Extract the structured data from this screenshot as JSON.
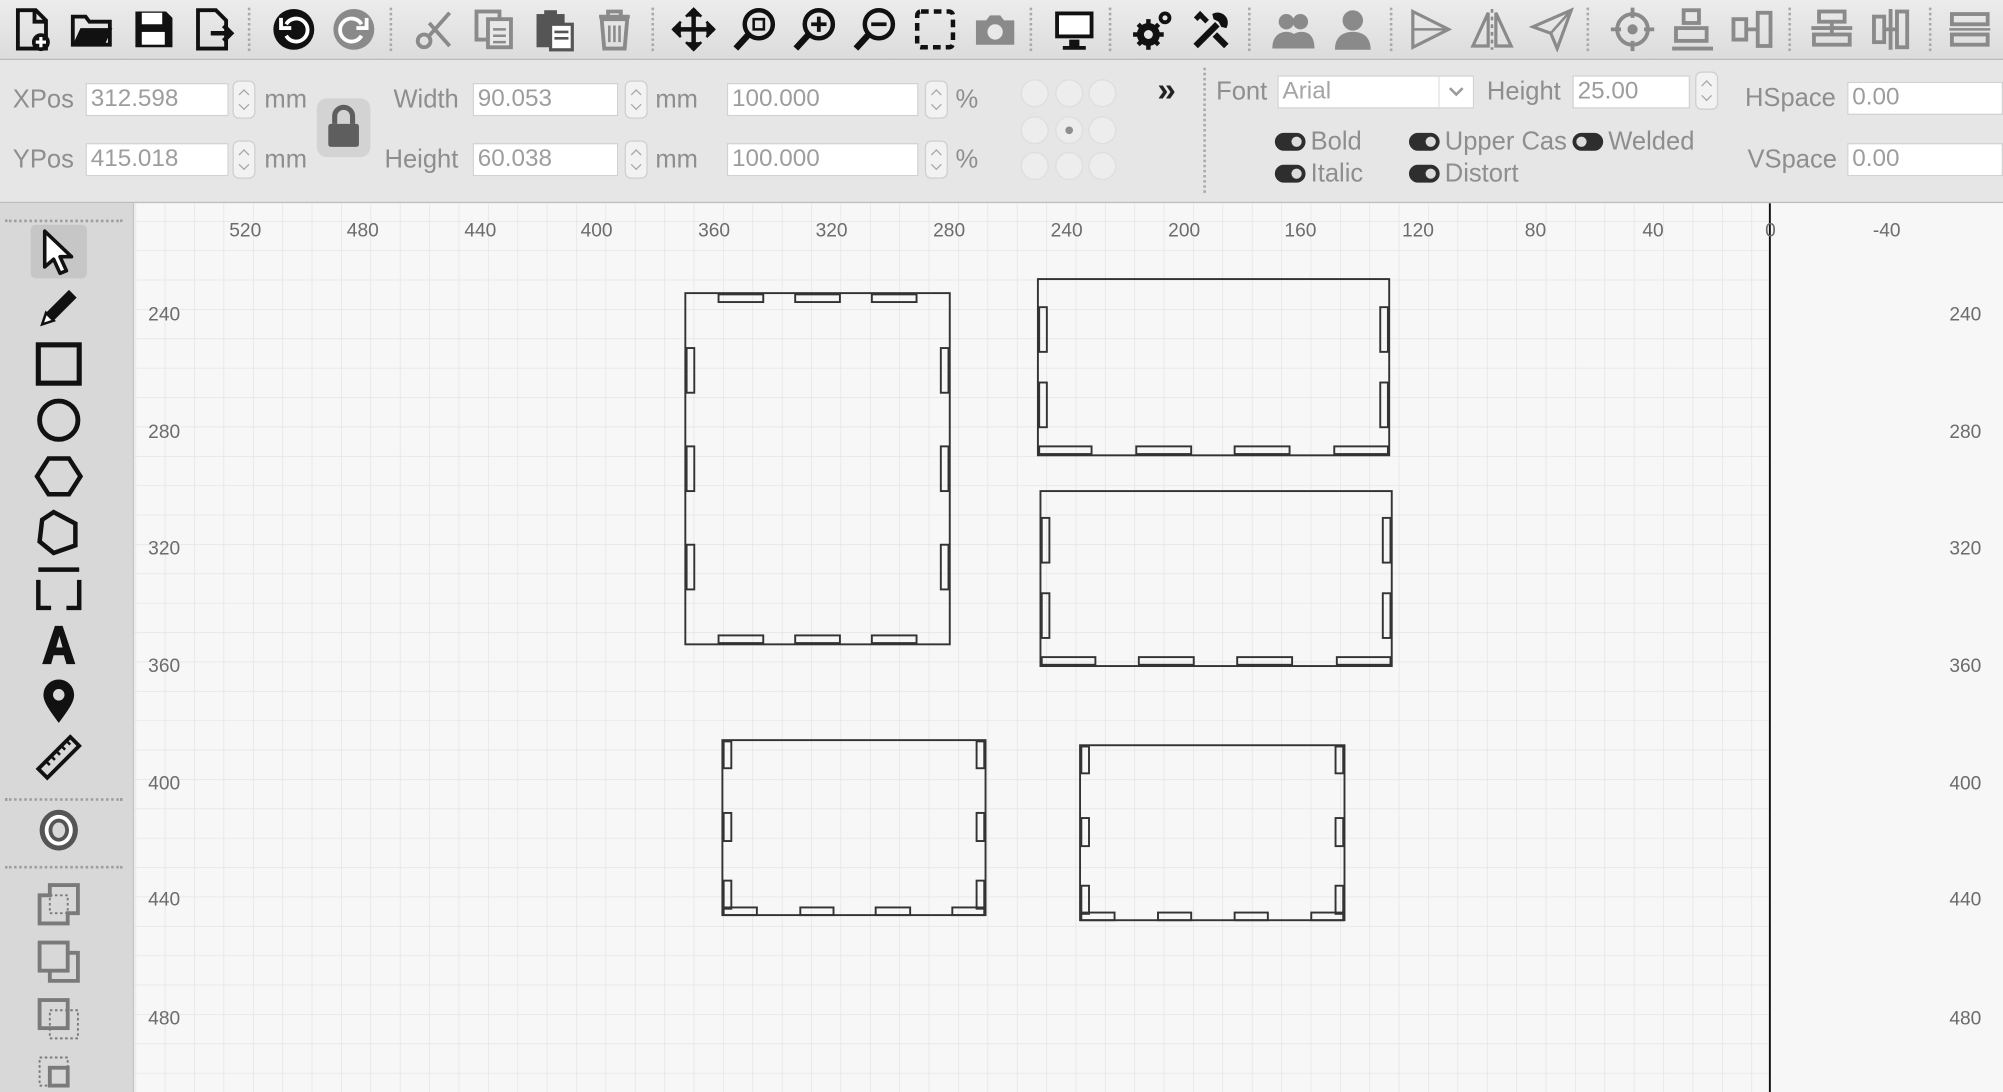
{
  "toolbar": {
    "icons": [
      "new-file-icon",
      "open-folder-icon",
      "save-icon",
      "export-icon",
      "undo-icon",
      "redo-icon",
      "cut-icon",
      "copy-icon",
      "paste-icon",
      "delete-icon",
      "move-icon",
      "zoom-to-page-icon",
      "zoom-in-icon",
      "zoom-out-icon",
      "select-frame-icon",
      "camera-icon",
      "monitor-icon",
      "settings-icon",
      "tools-icon",
      "users-icon",
      "user-icon",
      "flip-horizontal-icon",
      "mirror-icon",
      "send-icon",
      "target-icon",
      "align-bottom-icon",
      "align-center-icon",
      "distribute-vertical-icon",
      "distribute-horizontal-icon",
      "more-icon"
    ]
  },
  "position": {
    "xpos_label": "XPos",
    "xpos_value": "312.598",
    "ypos_label": "YPos",
    "ypos_value": "415.018",
    "unit": "mm"
  },
  "size": {
    "width_label": "Width",
    "width_value": "90.053",
    "height_label": "Height",
    "height_value": "60.038",
    "unit": "mm",
    "scale_x": "100.000",
    "scale_y": "100.000",
    "percent": "%"
  },
  "text": {
    "font_label": "Font",
    "font_value": "Arial",
    "height_label": "Height",
    "height_value": "25.00",
    "bold": "Bold",
    "italic": "Italic",
    "upper_case": "Upper Cas",
    "distort": "Distort",
    "welded": "Welded",
    "hspace_label": "HSpace",
    "hspace_value": "0.00",
    "vspace_label": "VSpace",
    "vspace_value": "0.00",
    "more": "»"
  },
  "tools": [
    "select-arrow-icon",
    "pencil-icon",
    "rectangle-icon",
    "ellipse-icon",
    "polygon-icon",
    "pentagon-icon",
    "frame-corners-icon",
    "text-icon",
    "position-marker-icon",
    "ruler-icon",
    "offset-icon",
    "boolean-union-icon",
    "boolean-subtract-icon",
    "boolean-intersect-icon",
    "boolean-xor-icon"
  ],
  "ruler_top": [
    "520",
    "480",
    "440",
    "400",
    "360",
    "320",
    "280",
    "240",
    "200",
    "160",
    "120",
    "80",
    "40",
    "0",
    "-40"
  ],
  "ruler_left": [
    "240",
    "280",
    "320",
    "360",
    "400",
    "440",
    "480"
  ],
  "ruler_right": [
    "240",
    "280",
    "320",
    "360",
    "400",
    "440",
    "480"
  ],
  "colors": {
    "grid": "#dedede",
    "canvas_bg": "#f7f7f7",
    "shape_stroke": "#333333"
  }
}
